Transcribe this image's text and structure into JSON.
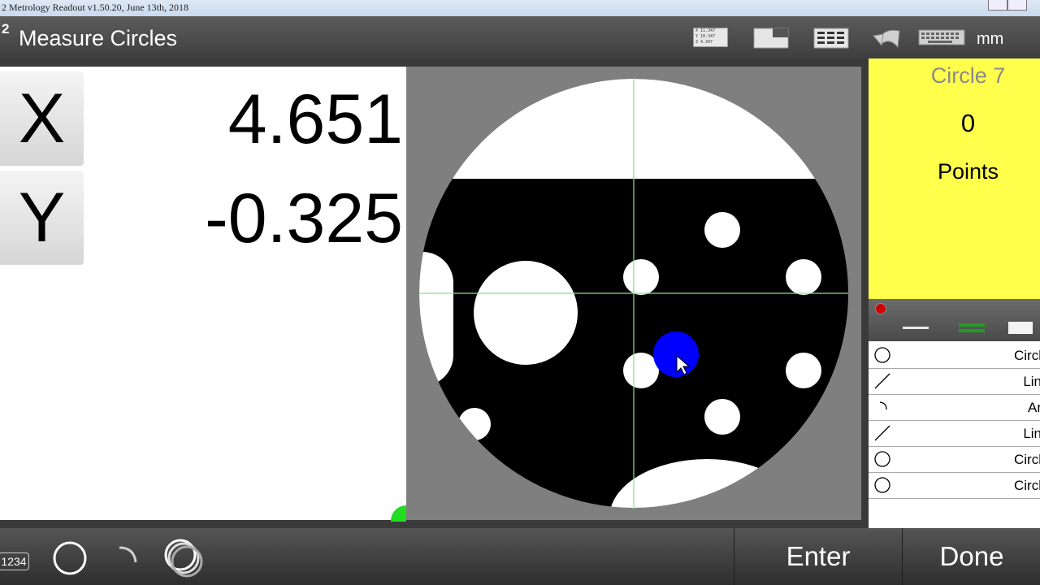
{
  "window": {
    "title": "2 Metrology Readout  v1.50.20, June 13th, 2018"
  },
  "header": {
    "step_number": "2",
    "title": "Measure Circles",
    "unit": "mm",
    "mini_readout": [
      "X 11.347",
      "Y 10.347",
      "Z 4.347"
    ]
  },
  "dro": {
    "axes": [
      {
        "label": "X",
        "value": "4.651"
      },
      {
        "label": "Y",
        "value": "-0.325"
      }
    ]
  },
  "feature": {
    "name": "Circle 7",
    "count": "0",
    "count_label": "Points"
  },
  "feature_list": {
    "items": [
      {
        "type": "circle",
        "label": "Circl"
      },
      {
        "type": "line",
        "label": "Lin"
      },
      {
        "type": "arc",
        "label": "Ar"
      },
      {
        "type": "line",
        "label": "Lin"
      },
      {
        "type": "circle",
        "label": "Circl"
      },
      {
        "type": "circle",
        "label": "Circl"
      }
    ]
  },
  "bottom": {
    "keypad_label": "1234",
    "enter_label": "Enter",
    "done_label": "Done"
  },
  "colors": {
    "feature_card": "#ffff4c",
    "crosshair": "#8fdc8f",
    "cursor_dot": "#0000ff",
    "status_dot": "#cc0000"
  }
}
